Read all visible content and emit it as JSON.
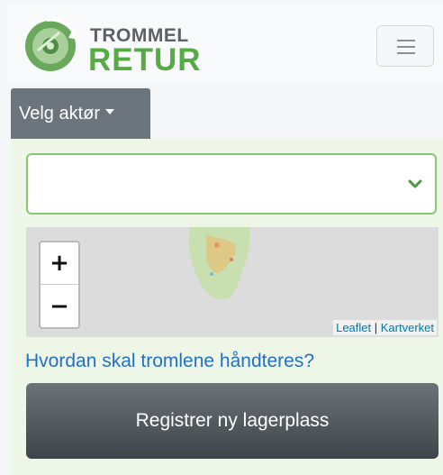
{
  "header": {
    "logo_line1": "TROMMEL",
    "logo_line2": "RETUR",
    "menu_icon": "hamburger-icon"
  },
  "actor_dropdown": {
    "label": "Velg aktør",
    "icon": "caret-down-icon"
  },
  "select": {
    "value": "",
    "icon": "chevron-down-icon"
  },
  "map": {
    "zoom_in_label": "+",
    "zoom_out_label": "−",
    "attribution": [
      "Leaflet",
      "Kartverket"
    ]
  },
  "help_link": "Hvordan skal tromlene håndteres?",
  "register_button": "Registrer ny lagerplass",
  "colors": {
    "brand_green": "#56ab45",
    "brand_grey": "#5b6167",
    "link_blue": "#1f71c7",
    "button_dark": "#3e4549",
    "panel_bg": "#eef6e8"
  }
}
